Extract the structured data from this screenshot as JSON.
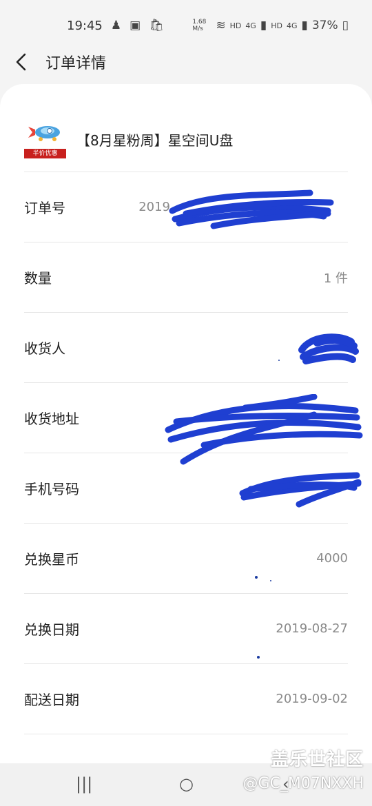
{
  "status_bar": {
    "time": "19:45",
    "net_speed": "1.68 M/s",
    "hd1": "HD",
    "lte1": "4G",
    "hd2": "HD",
    "lte2": "4G",
    "battery": "37%",
    "icons": [
      "notification-icon",
      "gallery-icon",
      "shopping-bag-icon",
      "wifi-icon",
      "signal-icon",
      "battery-icon"
    ]
  },
  "app_bar": {
    "title": "订单详情",
    "back_icon": "chevron-left-icon"
  },
  "product": {
    "name": "【8月星粉周】星空间U盘",
    "tag": "半价优惠"
  },
  "rows": [
    {
      "label": "订单号",
      "value": "2019"
    },
    {
      "label": "数量",
      "value": "1 件"
    },
    {
      "label": "收货人",
      "value": ""
    },
    {
      "label": "收货地址",
      "value": ""
    },
    {
      "label": "手机号码",
      "value": ""
    },
    {
      "label": "兑换星币",
      "value": "4000"
    },
    {
      "label": "兑换日期",
      "value": "2019-08-27"
    },
    {
      "label": "配送日期",
      "value": "2019-09-02"
    }
  ],
  "watermark": {
    "title": "盖乐世社区",
    "user": "@GC_M07NXXH"
  },
  "colors": {
    "scribble": "#1f3fd1",
    "tag_bg": "#c8201e"
  }
}
